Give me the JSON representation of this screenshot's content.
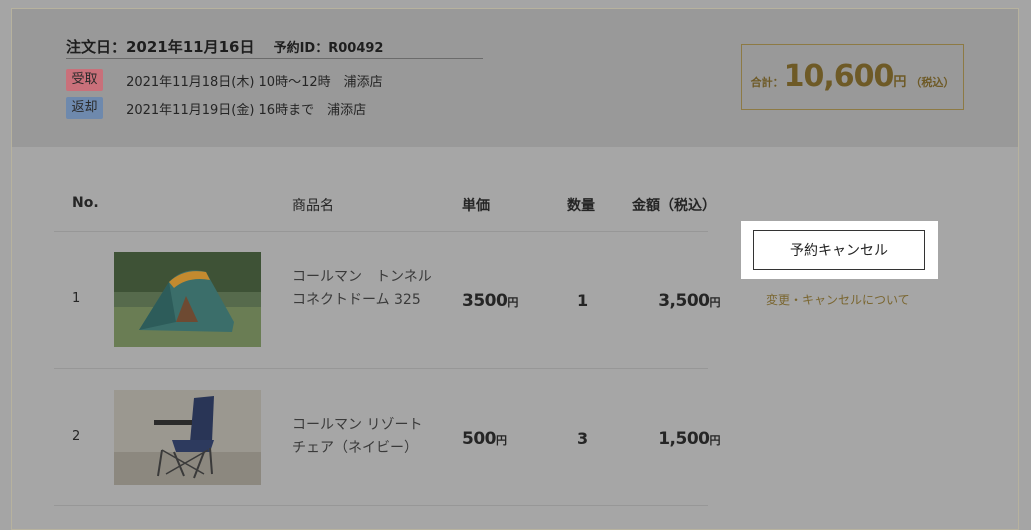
{
  "order": {
    "date_label": "注文日：2021年11月16日",
    "reserve_id": "予約ID：R00492"
  },
  "schedule": [
    {
      "badge": "受取",
      "text": "2021年11月18日(木) 10時〜12時　浦添店",
      "color": "#c9707a"
    },
    {
      "badge": "返却",
      "text": "2021年11月19日(金) 16時まで　浦添店",
      "color": "#6e89ad"
    }
  ],
  "total": {
    "label": "合計：",
    "amount": "10,600",
    "yen": "円",
    "tax": "（税込）"
  },
  "table": {
    "headers": {
      "no": "No.",
      "name": "商品名",
      "unit_price": "単価",
      "qty": "数量",
      "amount": "金額（税込）"
    },
    "rows": [
      {
        "no": "1",
        "name": "コールマン　トンネルコネクトドーム 325",
        "unit_price": "3500",
        "unit_yen": "円",
        "qty": "1",
        "amount": "3,500",
        "amount_yen": "円",
        "image": "tent-photo"
      },
      {
        "no": "2",
        "name": "コールマン リゾートチェア（ネイビー）",
        "unit_price": "500",
        "unit_yen": "円",
        "qty": "3",
        "amount": "1,500",
        "amount_yen": "円",
        "image": "chair-photo"
      }
    ]
  },
  "actions": {
    "cancel_label": "予約キャンセル",
    "policy_link": "変更・キャンセルについて"
  },
  "colors": {
    "overlay_bg": "#a5a5a5",
    "header_bg": "#999999",
    "gold": "#6e5a26",
    "link_gold": "#7a6630"
  }
}
